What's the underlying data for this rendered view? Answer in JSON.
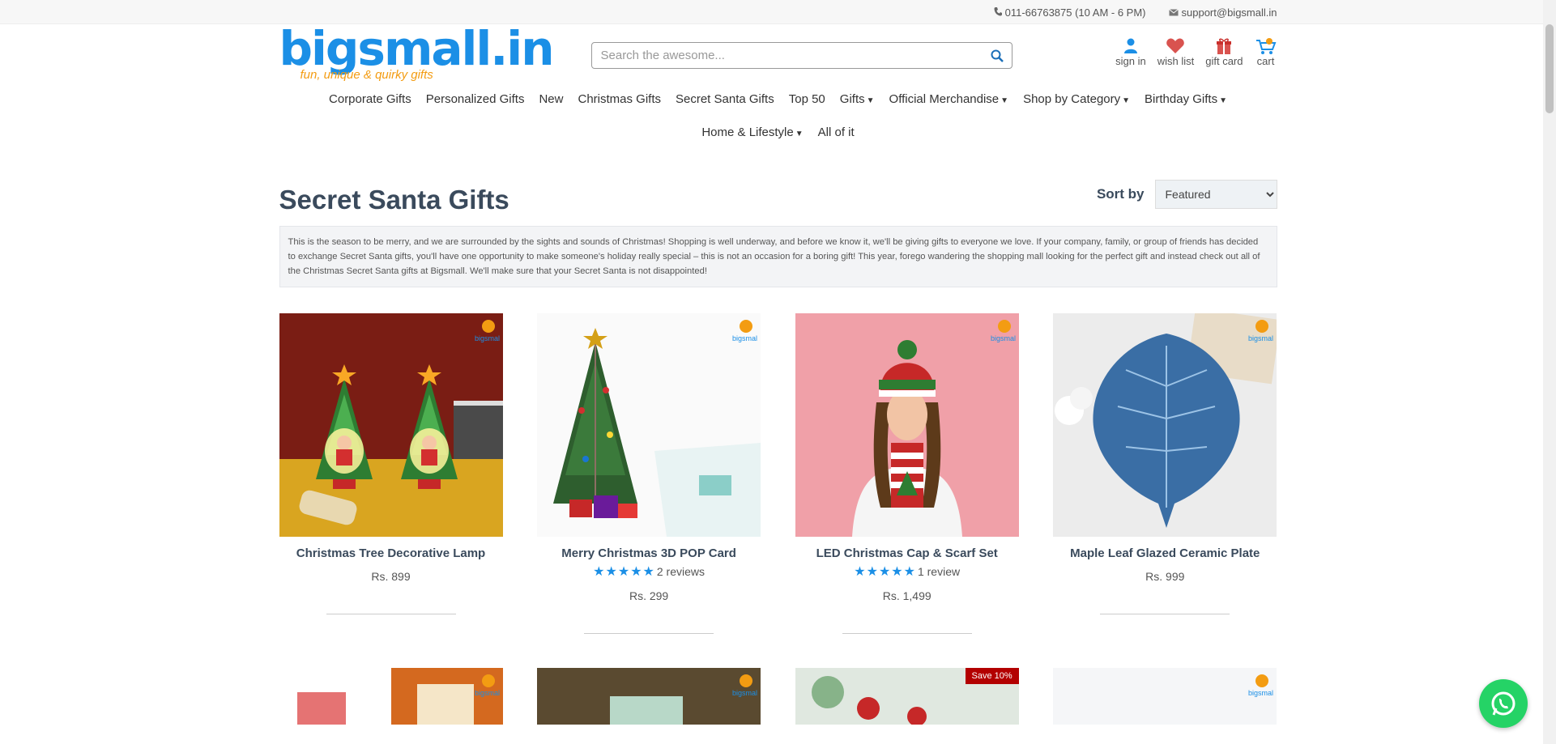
{
  "topbar": {
    "phone": "011-66763875 (10 AM - 6 PM)",
    "email": "support@bigsmall.in"
  },
  "logo": {
    "main": "bigsmall.in",
    "tagline": "fun, unique & quirky gifts"
  },
  "search": {
    "placeholder": "Search the awesome..."
  },
  "header_icons": {
    "signin": "sign in",
    "wishlist": "wish list",
    "giftcard": "gift card",
    "cart": "cart"
  },
  "nav": {
    "row1": [
      {
        "label": "Corporate Gifts"
      },
      {
        "label": "Personalized Gifts"
      },
      {
        "label": "New"
      },
      {
        "label": "Christmas Gifts"
      },
      {
        "label": "Secret Santa Gifts"
      },
      {
        "label": "Top 50"
      },
      {
        "label": "Gifts"
      },
      {
        "label": "Official Merchandise"
      },
      {
        "label": "Shop by Category"
      },
      {
        "label": "Birthday Gifts"
      }
    ],
    "row2": [
      {
        "label": "Home & Lifestyle"
      },
      {
        "label": "All of it"
      }
    ]
  },
  "page": {
    "title": "Secret Santa Gifts",
    "sort_label": "Sort by",
    "sort_selected": "Featured",
    "description": "This is the season to be merry, and we are surrounded by the sights and sounds of Christmas! Shopping is well underway, and before we know it, we'll be giving gifts to everyone we love. If your company, family, or group of friends has decided to exchange Secret Santa gifts, you'll have one opportunity to make someone's holiday really special – this is not an occasion for a boring gift! This year, forego wandering the shopping mall looking for the perfect gift and instead check out all of the Christmas Secret Santa gifts at Bigsmall. We'll make sure that your Secret Santa is not disappointed!"
  },
  "products": [
    {
      "name": "Christmas Tree Decorative Lamp",
      "price": "Rs. 899",
      "reviews": ""
    },
    {
      "name": "Merry Christmas 3D POP Card",
      "price": "Rs. 299",
      "reviews": "2 reviews"
    },
    {
      "name": "LED Christmas Cap & Scarf Set",
      "price": "Rs. 1,499",
      "reviews": "1 review"
    },
    {
      "name": "Maple Leaf Glazed Ceramic Plate",
      "price": "Rs. 999",
      "reviews": ""
    }
  ],
  "row2": {
    "save_badge": "Save 10%"
  },
  "colors": {
    "brand_blue": "#1b8fe6",
    "brand_orange": "#f39c12",
    "text": "#3a4a5c",
    "save_red": "#b30000",
    "whatsapp": "#25d366"
  }
}
